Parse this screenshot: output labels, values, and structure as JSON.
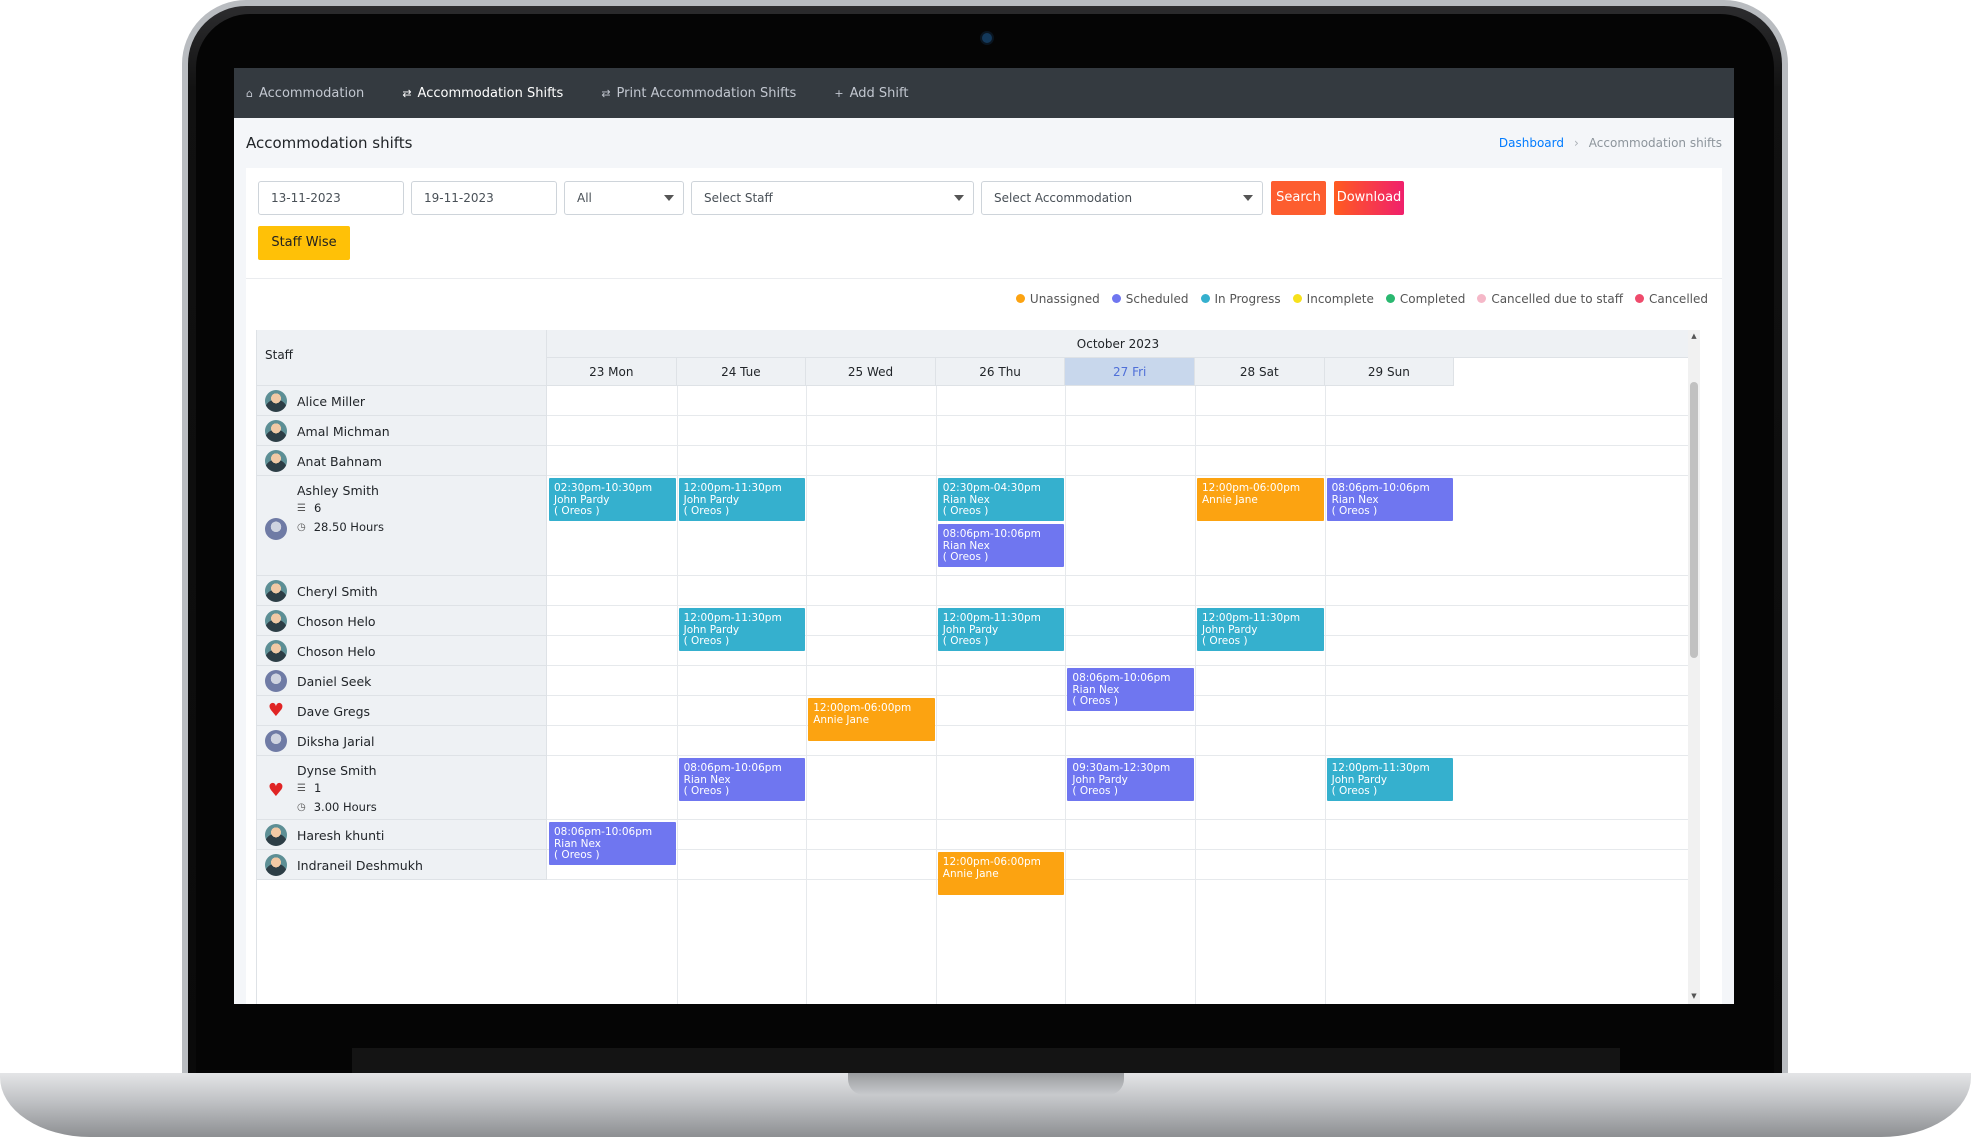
{
  "nav": {
    "items": [
      {
        "icon": "home-icon",
        "label": "Accommodation"
      },
      {
        "icon": "shuffle-icon",
        "label": "Accommodation Shifts"
      },
      {
        "icon": "shuffle-icon",
        "label": "Print Accommodation Shifts"
      },
      {
        "icon": "plus-icon",
        "label": "Add Shift"
      }
    ],
    "active": "Accommodation Shifts"
  },
  "page": {
    "title": "Accommodation shifts",
    "breadcrumb": {
      "home": "Dashboard",
      "separator": "›",
      "current": "Accommodation shifts"
    }
  },
  "filters": {
    "start_date": "13-11-2023",
    "end_date": "19-11-2023",
    "status": "All",
    "staff_placeholder": "Select Staff",
    "accommodation_placeholder": "Select Accommodation",
    "search_label": "Search",
    "download_label": "Download",
    "staff_wise_label": "Staff Wise"
  },
  "legend": [
    {
      "label": "Unassigned",
      "color": "#fca311"
    },
    {
      "label": "Scheduled",
      "color": "#6f76f0"
    },
    {
      "label": "In Progress",
      "color": "#35b0ce"
    },
    {
      "label": "Incomplete",
      "color": "#f7e11c"
    },
    {
      "label": "Completed",
      "color": "#2ab870"
    },
    {
      "label": "Cancelled due to staff",
      "color": "#f5b8c8"
    },
    {
      "label": "Cancelled",
      "color": "#ef4b6c"
    }
  ],
  "calendar": {
    "staff_header": "Staff",
    "month_label": "October 2023",
    "today": "27 Fri",
    "days": [
      "23 Mon",
      "24 Tue",
      "25 Wed",
      "26 Thu",
      "27 Fri",
      "28 Sat",
      "29 Sun"
    ],
    "staff": [
      {
        "name": "Alice Miller",
        "avatar": "photo"
      },
      {
        "name": "Amal Michman",
        "avatar": "photo"
      },
      {
        "name": "Anat Bahnam",
        "avatar": "photo"
      },
      {
        "name": "Ashley Smith",
        "avatar": "photo2",
        "shifts": "6",
        "hours": "28.50 Hours"
      },
      {
        "name": "Cheryl Smith",
        "avatar": "photo"
      },
      {
        "name": "Choson Helo",
        "avatar": "photo"
      },
      {
        "name": "Choson Helo",
        "avatar": "photo"
      },
      {
        "name": "Daniel Seek",
        "avatar": "photo2"
      },
      {
        "name": "Dave Gregs",
        "avatar": "heart"
      },
      {
        "name": "Diksha Jarial",
        "avatar": "photo2"
      },
      {
        "name": "Dynse Smith",
        "avatar": "heart",
        "shifts": "1",
        "hours": "3.00 Hours"
      },
      {
        "name": "Haresh khunti",
        "avatar": "photo"
      },
      {
        "name": "Indraneil Deshmukh",
        "avatar": "photo"
      }
    ],
    "events": [
      {
        "staff": 3,
        "day": 0,
        "slot": 0,
        "status": "prog",
        "time": "02:30pm-10:30pm",
        "person": "John Pardy",
        "place": "( Oreos )"
      },
      {
        "staff": 3,
        "day": 1,
        "slot": 0,
        "status": "prog",
        "time": "12:00pm-11:30pm",
        "person": "John Pardy",
        "place": "( Oreos )"
      },
      {
        "staff": 3,
        "day": 3,
        "slot": 0,
        "status": "prog",
        "time": "02:30pm-04:30pm",
        "person": "Rian Nex",
        "place": "( Oreos )"
      },
      {
        "staff": 3,
        "day": 3,
        "slot": 1,
        "status": "sched",
        "time": "08:06pm-10:06pm",
        "person": "Rian Nex",
        "place": "( Oreos )"
      },
      {
        "staff": 3,
        "day": 5,
        "slot": 0,
        "status": "unas",
        "time": "12:00pm-06:00pm",
        "person": "Annie Jane",
        "place": ""
      },
      {
        "staff": 3,
        "day": 6,
        "slot": 0,
        "status": "sched",
        "time": "08:06pm-10:06pm",
        "person": "Rian Nex",
        "place": "( Oreos )"
      },
      {
        "staff": 5,
        "day": 1,
        "slot": 0,
        "status": "prog",
        "time": "12:00pm-11:30pm",
        "person": "John Pardy",
        "place": "( Oreos )"
      },
      {
        "staff": 5,
        "day": 3,
        "slot": 0,
        "status": "prog",
        "time": "12:00pm-11:30pm",
        "person": "John Pardy",
        "place": "( Oreos )"
      },
      {
        "staff": 5,
        "day": 5,
        "slot": 0,
        "status": "prog",
        "time": "12:00pm-11:30pm",
        "person": "John Pardy",
        "place": "( Oreos )"
      },
      {
        "staff": 7,
        "day": 4,
        "slot": 0,
        "status": "sched",
        "time": "08:06pm-10:06pm",
        "person": "Rian Nex",
        "place": "( Oreos )"
      },
      {
        "staff": 8,
        "day": 2,
        "slot": 0,
        "status": "unas",
        "time": "12:00pm-06:00pm",
        "person": "Annie Jane",
        "place": ""
      },
      {
        "staff": 10,
        "day": 1,
        "slot": 0,
        "status": "sched",
        "time": "08:06pm-10:06pm",
        "person": "Rian Nex",
        "place": "( Oreos )"
      },
      {
        "staff": 10,
        "day": 4,
        "slot": 0,
        "status": "sched",
        "time": "09:30am-12:30pm",
        "person": "John Pardy",
        "place": "( Oreos )"
      },
      {
        "staff": 10,
        "day": 6,
        "slot": 0,
        "status": "prog",
        "time": "12:00pm-11:30pm",
        "person": "John Pardy",
        "place": "( Oreos )"
      },
      {
        "staff": 11,
        "day": 0,
        "slot": 0,
        "status": "sched",
        "time": "08:06pm-10:06pm",
        "person": "Rian Nex",
        "place": "( Oreos )"
      },
      {
        "staff": 12,
        "day": 3,
        "slot": 0,
        "status": "unas",
        "time": "12:00pm-06:00pm",
        "person": "Annie Jane",
        "place": ""
      }
    ]
  }
}
